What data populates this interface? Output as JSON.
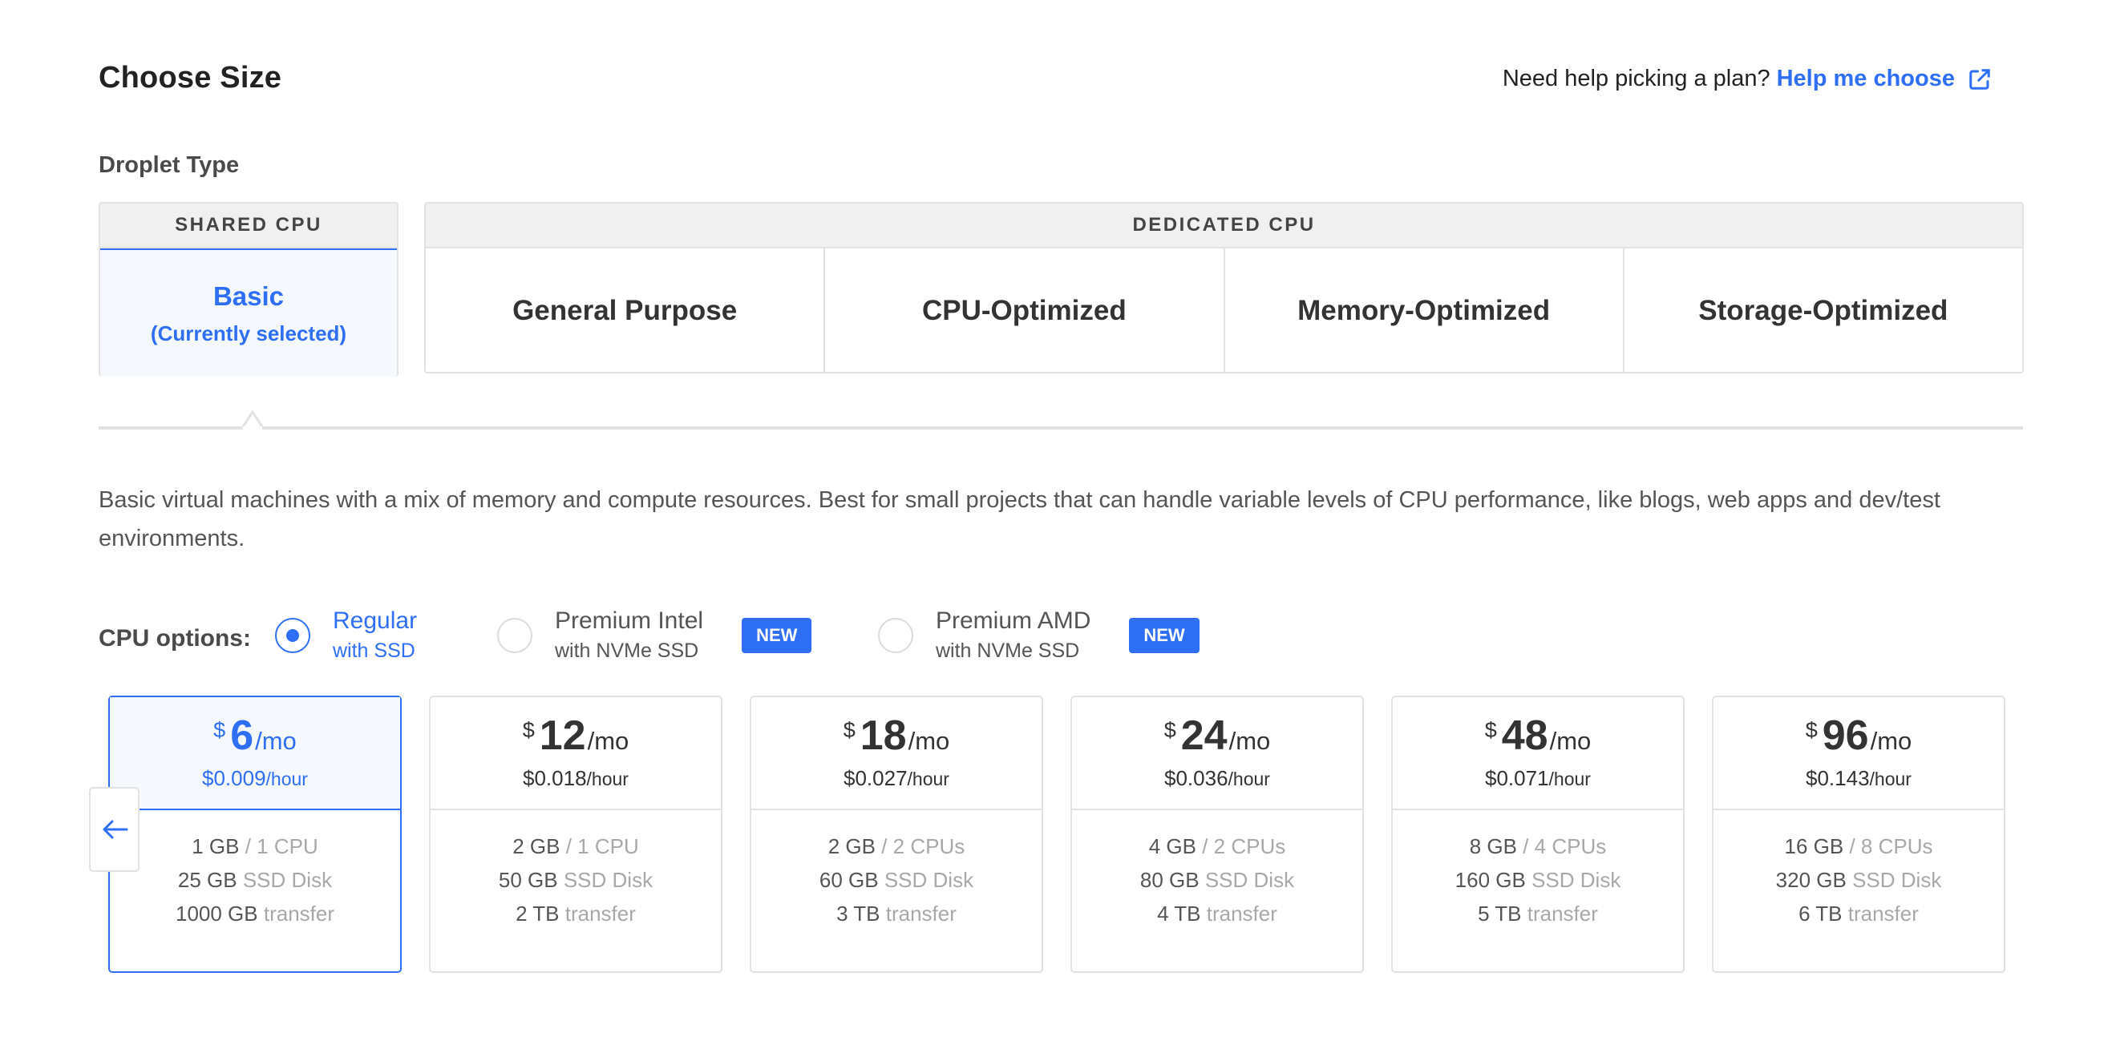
{
  "header": {
    "title": "Choose Size",
    "help_prompt": "Need help picking a plan?",
    "help_link": "Help me choose",
    "help_icon": "external-link-icon"
  },
  "droplet_type": {
    "label": "Droplet Type",
    "shared": {
      "heading": "SHARED CPU",
      "option": {
        "name": "Basic",
        "note": "(Currently selected)",
        "selected": true
      }
    },
    "dedicated": {
      "heading": "DEDICATED CPU",
      "options": [
        {
          "name": "General Purpose"
        },
        {
          "name": "CPU-Optimized"
        },
        {
          "name": "Memory-Optimized"
        },
        {
          "name": "Storage-Optimized"
        }
      ]
    }
  },
  "description": "Basic virtual machines with a mix of memory and compute resources. Best for small projects that can handle variable levels of CPU performance, like blogs, web apps and dev/test environments.",
  "cpu_options": {
    "label": "CPU options:",
    "options": [
      {
        "title": "Regular",
        "subtitle": "with SSD",
        "selected": true,
        "badge": ""
      },
      {
        "title": "Premium Intel",
        "subtitle": "with NVMe SSD",
        "selected": false,
        "badge": "NEW"
      },
      {
        "title": "Premium AMD",
        "subtitle": "with NVMe SSD",
        "selected": false,
        "badge": "NEW"
      }
    ]
  },
  "plans": {
    "scroll_left_icon": "arrow-left-icon",
    "currency": "$",
    "per_month": "/mo",
    "per_hour": "/hour",
    "items": [
      {
        "monthly": "6",
        "hourly": "$0.009",
        "memory": "1 GB",
        "cpu": "/ 1 CPU",
        "disk": "25 GB",
        "disk_label": "SSD Disk",
        "transfer": "1000 GB",
        "transfer_label": "transfer",
        "selected": true
      },
      {
        "monthly": "12",
        "hourly": "$0.018",
        "memory": "2 GB",
        "cpu": "/ 1 CPU",
        "disk": "50 GB",
        "disk_label": "SSD Disk",
        "transfer": "2 TB",
        "transfer_label": "transfer",
        "selected": false
      },
      {
        "monthly": "18",
        "hourly": "$0.027",
        "memory": "2 GB",
        "cpu": "/ 2 CPUs",
        "disk": "60 GB",
        "disk_label": "SSD Disk",
        "transfer": "3 TB",
        "transfer_label": "transfer",
        "selected": false
      },
      {
        "monthly": "24",
        "hourly": "$0.036",
        "memory": "4 GB",
        "cpu": "/ 2 CPUs",
        "disk": "80 GB",
        "disk_label": "SSD Disk",
        "transfer": "4 TB",
        "transfer_label": "transfer",
        "selected": false
      },
      {
        "monthly": "48",
        "hourly": "$0.071",
        "memory": "8 GB",
        "cpu": "/ 4 CPUs",
        "disk": "160 GB",
        "disk_label": "SSD Disk",
        "transfer": "5 TB",
        "transfer_label": "transfer",
        "selected": false
      },
      {
        "monthly": "96",
        "hourly": "$0.143",
        "memory": "16 GB",
        "cpu": "/ 8 CPUs",
        "disk": "320 GB",
        "disk_label": "SSD Disk",
        "transfer": "6 TB",
        "transfer_label": "transfer",
        "selected": false
      }
    ]
  },
  "colors": {
    "accent": "#2f6ff5",
    "border": "#e2e2e2",
    "selected_bg": "#f5f8fd",
    "header_bg": "#f0f0f0"
  }
}
